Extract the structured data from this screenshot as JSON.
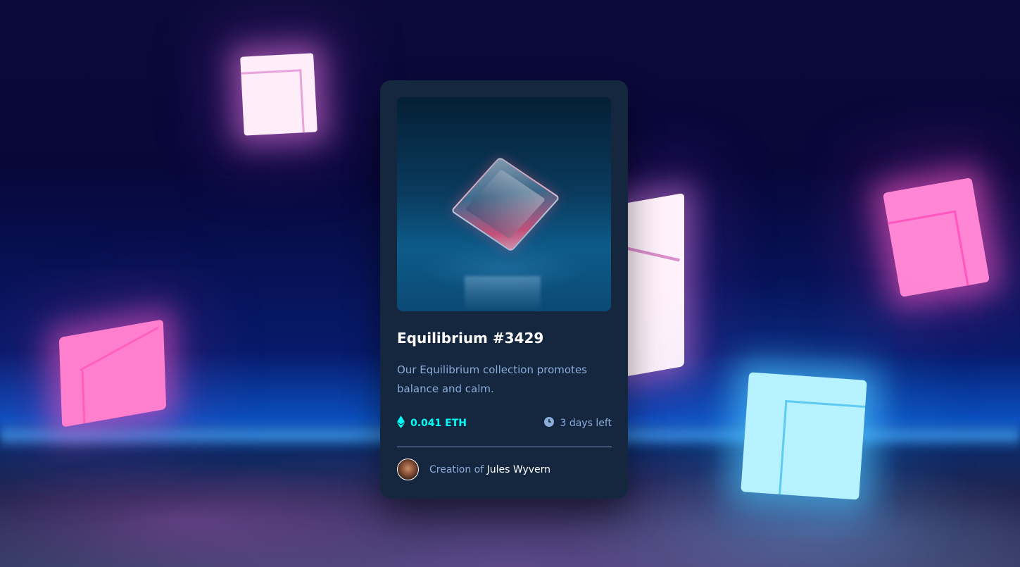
{
  "card": {
    "title": "Equilibrium #3429",
    "description": "Our Equilibrium collection promotes balance and calm.",
    "price": "0.041 ETH",
    "time_left": "3 days left",
    "creator_prefix": "Creation of",
    "creator_name": "Jules Wyvern"
  },
  "icons": {
    "price_icon": "ethereum-icon",
    "time_icon": "clock-icon"
  },
  "colors": {
    "card_bg": "#15263f",
    "accent_cyan": "#00fff8",
    "soft_blue": "#8bacd9",
    "white": "#ffffff"
  }
}
